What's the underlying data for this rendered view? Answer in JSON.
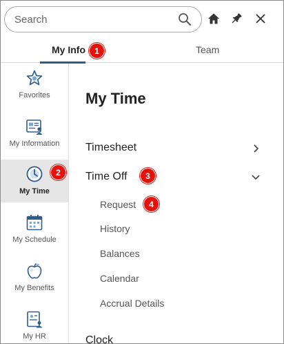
{
  "search": {
    "placeholder": "Search"
  },
  "header_icons": [
    "search-icon",
    "home-icon",
    "pin-icon",
    "close-icon"
  ],
  "tabs": [
    {
      "label": "My Info",
      "active": true,
      "badge": "1"
    },
    {
      "label": "Team",
      "active": false
    }
  ],
  "sidebar": {
    "items": [
      {
        "label": "Favorites",
        "icon": "star-icon"
      },
      {
        "label": "My Information",
        "icon": "id-card-icon"
      },
      {
        "label": "My Time",
        "icon": "clock-icon",
        "active": true,
        "badge": "2"
      },
      {
        "label": "My Schedule",
        "icon": "calendar-icon"
      },
      {
        "label": "My Benefits",
        "icon": "apple-icon"
      },
      {
        "label": "My HR",
        "icon": "hr-document-icon"
      }
    ]
  },
  "main": {
    "title": "My Time",
    "menu": [
      {
        "label": "Timesheet",
        "state": "collapsed"
      },
      {
        "label": "Time Off",
        "state": "expanded",
        "badge": "3",
        "children": [
          {
            "label": "Request",
            "badge": "4"
          },
          {
            "label": "History"
          },
          {
            "label": "Balances"
          },
          {
            "label": "Calendar"
          },
          {
            "label": "Accrual Details"
          }
        ]
      },
      {
        "label": "Clock"
      }
    ]
  },
  "colors": {
    "accent": "#2f5c8a",
    "badge": "#e3120b",
    "active_bg": "#e6e6e6"
  }
}
